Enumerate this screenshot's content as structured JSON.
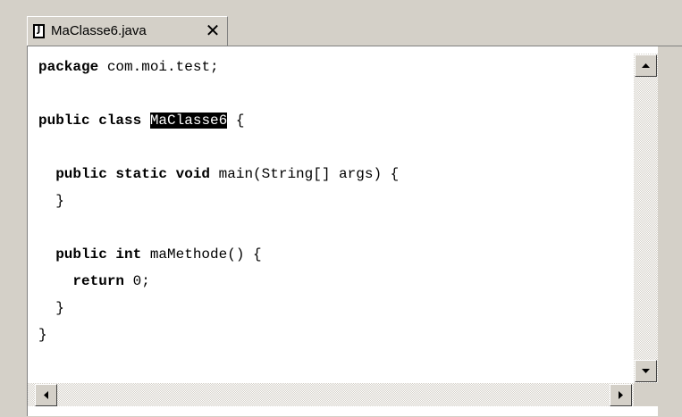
{
  "tab": {
    "title": "MaClasse6.java",
    "icon_letter": "J",
    "close_label": "✕"
  },
  "code": {
    "line1_kw": "package",
    "line1_rest": " com.moi.test;",
    "line3_kw": "public class",
    "line3_sel": "MaClasse6",
    "line3_rest": " {",
    "line5_indent": "  ",
    "line5_kw": "public static void",
    "line5_rest": " main(String[] args) {",
    "line6": "  }",
    "line8_indent": "  ",
    "line8_kw": "public int",
    "line8_rest": " maMethode() {",
    "line9_indent": "    ",
    "line9_kw": "return",
    "line9_rest": " 0;",
    "line10": "  }",
    "line11": "}"
  },
  "colors": {
    "background": "#d4d0c8",
    "editor": "#ffffff",
    "selection": "#000000"
  },
  "icons": {
    "file": "java-file-icon",
    "close": "close-icon",
    "up": "arrow-up-icon",
    "down": "arrow-down-icon",
    "left": "arrow-left-icon",
    "right": "arrow-right-icon"
  }
}
